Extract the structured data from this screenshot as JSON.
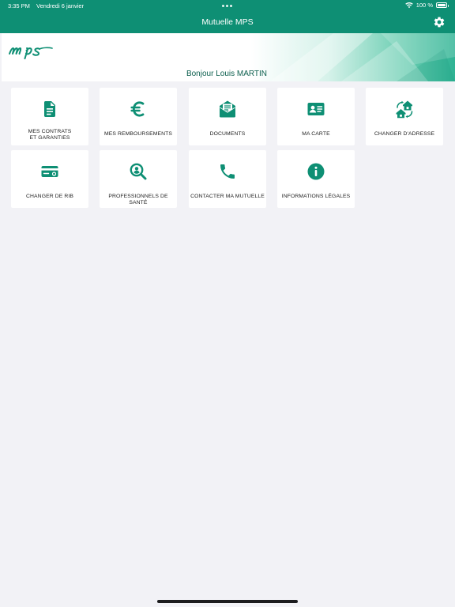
{
  "status_bar": {
    "time": "3:35 PM",
    "date": "Vendredi 6 janvier",
    "battery": "100 %"
  },
  "nav": {
    "title": "Mutuelle MPS"
  },
  "banner": {
    "greeting": "Bonjour Louis MARTIN"
  },
  "colors": {
    "brand": "#0e8f74",
    "icon": "#0e8f74",
    "background": "#f2f2f6"
  },
  "tiles": [
    {
      "label_line1": "MES CONTRATS",
      "label_line2": "ET GARANTIES",
      "icon": "document-icon"
    },
    {
      "label": "MES REMBOURSEMENTS",
      "icon": "euro-icon"
    },
    {
      "label": "DOCUMENTS",
      "icon": "envelope-icon"
    },
    {
      "label": "MA CARTE",
      "icon": "id-card-icon"
    },
    {
      "label": "CHANGER D'ADRESSE",
      "icon": "moving-house-icon"
    },
    {
      "label": "CHANGER DE RIB",
      "icon": "credit-card-icon"
    },
    {
      "label": "PROFESSIONNELS DE SANTÉ",
      "icon": "search-person-icon"
    },
    {
      "label": "CONTACTER MA MUTUELLE",
      "icon": "phone-icon"
    },
    {
      "label": "INFORMATIONS LÉGALES",
      "icon": "info-icon"
    }
  ]
}
